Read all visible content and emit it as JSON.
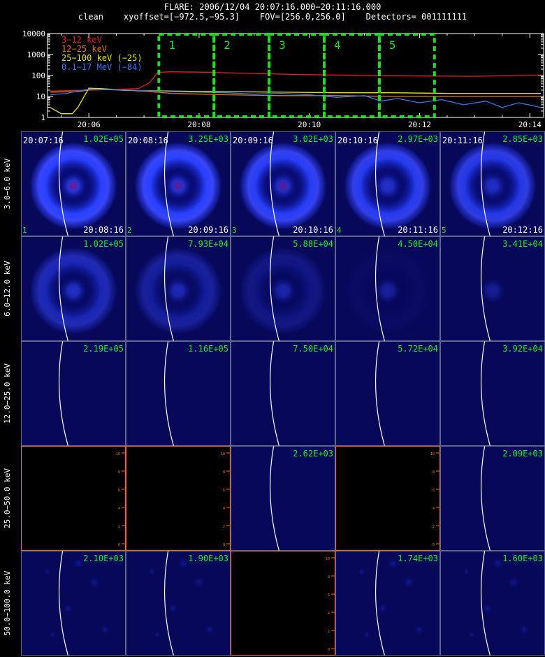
{
  "header": {
    "title": "FLARE: 2006/12/04 20:07:16.000−20:11:16.000",
    "subtitle": "clean    xyoffset=[−972.5,−95.3]    FOV=[256.0,256.0]    Detectors= 001111111"
  },
  "chart_data": [
    {
      "type": "line",
      "name": "lightcurve",
      "x_tick_labels": [
        "20:06",
        "20:08",
        "20:10",
        "20:12",
        "20:14"
      ],
      "x_tick_minutes": [
        6,
        8,
        10,
        12,
        14
      ],
      "xlim_minutes": [
        5.25,
        14.25
      ],
      "y_tick_labels": [
        "1",
        "10",
        "100",
        "1000",
        "10000"
      ],
      "ylim": [
        1,
        10000
      ],
      "yscale": "log",
      "series": [
        {
          "name": "3−12 keV",
          "color": "#e02020",
          "x": [
            5.3,
            6.0,
            6.6,
            6.9,
            7.1,
            7.25,
            7.5,
            8.0,
            9.0,
            10.0,
            11.0,
            12.0,
            13.0,
            14.2
          ],
          "y": [
            18,
            20,
            22,
            24,
            45,
            140,
            150,
            145,
            125,
            110,
            100,
            95,
            92,
            105
          ]
        },
        {
          "name": "12−25 keV",
          "color": "#e07818",
          "x": [
            5.3,
            5.8,
            6.1,
            6.6,
            7.0,
            7.5,
            8.5,
            9.5,
            10.5,
            11.5,
            12.5,
            13.5,
            14.2
          ],
          "y": [
            16,
            17,
            22,
            20,
            18,
            14,
            12,
            11,
            11,
            10,
            10,
            10,
            10
          ]
        },
        {
          "name": "25−100 keV (−25)",
          "color": "#e8e800",
          "x": [
            5.3,
            5.5,
            5.7,
            5.8,
            6.0,
            6.2,
            6.4,
            6.6,
            7.0,
            7.5,
            8.5,
            9.5,
            10.5,
            11.5,
            12.5,
            13.5,
            14.2
          ],
          "y": [
            3,
            1.5,
            1.5,
            3,
            25,
            24,
            22,
            20,
            19,
            18,
            17,
            16,
            15,
            15,
            14,
            14,
            14
          ]
        },
        {
          "name": "0.1−17 MeV (−84)",
          "color": "#3a78f0",
          "x": [
            5.3,
            5.6,
            5.8,
            6.0,
            6.5,
            7.0,
            7.5,
            8.0,
            8.5,
            9.0,
            9.5,
            10.0,
            10.5,
            11.0,
            11.3,
            11.6,
            12.0,
            12.4,
            12.8,
            13.2,
            13.5,
            13.8,
            14.2
          ],
          "y": [
            12,
            14,
            18,
            22,
            21,
            19,
            17,
            16,
            15,
            13,
            14,
            12,
            9,
            11,
            6,
            8,
            5,
            7,
            4,
            6,
            3,
            5,
            3
          ]
        }
      ],
      "intervals": [
        {
          "label": "1",
          "start_min": 7.27,
          "end_min": 8.27
        },
        {
          "label": "2",
          "start_min": 8.27,
          "end_min": 9.27
        },
        {
          "label": "3",
          "start_min": 9.27,
          "end_min": 10.27
        },
        {
          "label": "4",
          "start_min": 10.27,
          "end_min": 11.27
        },
        {
          "label": "5",
          "start_min": 11.27,
          "end_min": 12.27
        }
      ]
    },
    {
      "type": "heatmap",
      "name": "image-grid",
      "energy_bands": [
        "3.0−6.0 keV",
        "6.0−12.0 keV",
        "12.0−25.0 keV",
        "25.0−50.0 keV",
        "50.0−100.0 keV"
      ],
      "start_times": [
        "20:07:16",
        "20:08:16",
        "20:09:16",
        "20:10:16",
        "20:11:16"
      ],
      "end_times": [
        "20:08:16",
        "20:09:16",
        "20:10:16",
        "20:11:16",
        "20:12:16"
      ],
      "interval_numbers": [
        "1",
        "2",
        "3",
        "4",
        "5"
      ],
      "panels": [
        [
          {
            "max": "1.02E+05",
            "kind": "ring",
            "ring": 1.0,
            "core": 0.8
          },
          {
            "max": "3.25E+03",
            "kind": "ring",
            "ring": 1.0,
            "core": 0.7
          },
          {
            "max": "3.02E+03",
            "kind": "ring",
            "ring": 0.95,
            "core": 0.65
          },
          {
            "max": "2.97E+03",
            "kind": "ring",
            "ring": 0.9,
            "core": 0.6
          },
          {
            "max": "2.85E+03",
            "kind": "ring",
            "ring": 0.85,
            "core": 0.55
          }
        ],
        [
          {
            "max": "1.02E+05",
            "kind": "ring",
            "ring": 0.55,
            "core": 0.6
          },
          {
            "max": "7.93E+04",
            "kind": "ring",
            "ring": 0.4,
            "core": 0.5
          },
          {
            "max": "5.88E+04",
            "kind": "ring",
            "ring": 0.25,
            "core": 0.45
          },
          {
            "max": "4.50E+04",
            "kind": "ring",
            "ring": 0.05,
            "core": 0.4
          },
          {
            "max": "3.41E+04",
            "kind": "ring",
            "ring": 0.0,
            "core": 0.35
          }
        ],
        [
          {
            "max": "2.19E+05",
            "kind": "faint"
          },
          {
            "max": "1.16E+05",
            "kind": "faint"
          },
          {
            "max": "7.50E+04",
            "kind": "faint"
          },
          {
            "max": "5.72E+04",
            "kind": "faint"
          },
          {
            "max": "3.92E+04",
            "kind": "faint"
          }
        ],
        [
          {
            "max": "",
            "kind": "empty"
          },
          {
            "max": "",
            "kind": "empty"
          },
          {
            "max": "2.62E+03",
            "kind": "faint"
          },
          {
            "max": "",
            "kind": "empty"
          },
          {
            "max": "2.09E+03",
            "kind": "faint"
          }
        ],
        [
          {
            "max": "2.10E+03",
            "kind": "noise"
          },
          {
            "max": "1.90E+03",
            "kind": "noise"
          },
          {
            "max": "",
            "kind": "empty"
          },
          {
            "max": "1.74E+03",
            "kind": "noise"
          },
          {
            "max": "1.60E+03",
            "kind": "noise"
          }
        ]
      ]
    }
  ],
  "colors": {
    "background": "#000000",
    "interval_box": "#22dd22",
    "panel_label": "#22ee22",
    "empty_axis": "#ff6a00",
    "panel_bg": "#07085a",
    "limb": "#ffffff"
  }
}
